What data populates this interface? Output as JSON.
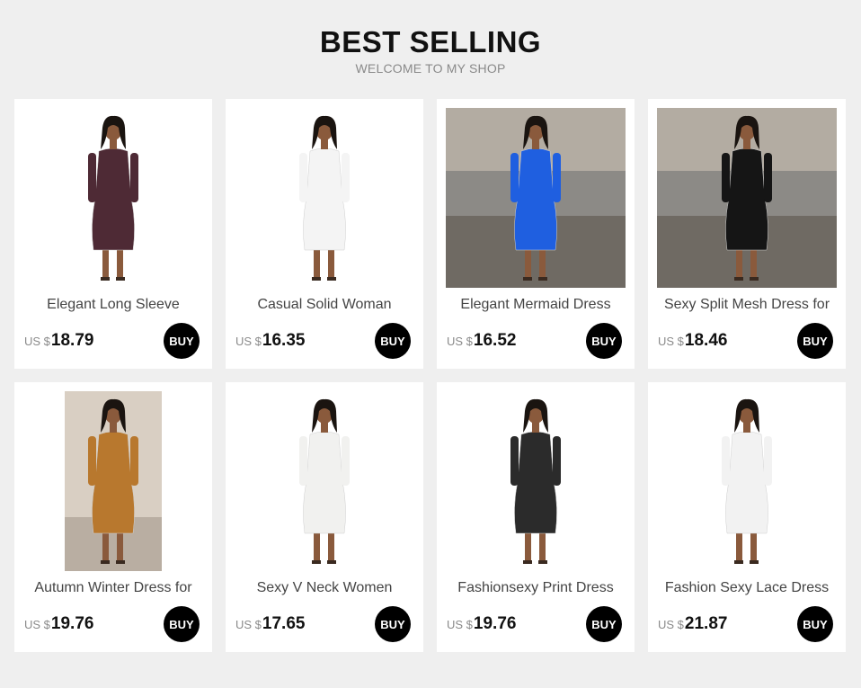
{
  "header": {
    "title": "BEST SELLING",
    "subtitle": "WELCOME TO MY SHOP"
  },
  "colors": {
    "background": "#efefef",
    "card": "#ffffff",
    "buy_button": "#000000"
  },
  "products": [
    {
      "name": "Elegant Long Sleeve",
      "currency": "US $",
      "price": "18.79",
      "buy_label": "BUY",
      "dress_color": "#4e2a35",
      "scene": "studio"
    },
    {
      "name": "Casual Solid Woman",
      "currency": "US $",
      "price": "16.35",
      "buy_label": "BUY",
      "dress_color": "#f4f4f4",
      "scene": "studio"
    },
    {
      "name": "Elegant Mermaid Dress",
      "currency": "US $",
      "price": "16.52",
      "buy_label": "BUY",
      "dress_color": "#1f5fe0",
      "scene": "outdoor"
    },
    {
      "name": "Sexy Split Mesh Dress for",
      "currency": "US $",
      "price": "18.46",
      "buy_label": "BUY",
      "dress_color": "#151515",
      "scene": "outdoor"
    },
    {
      "name": "Autumn Winter Dress for",
      "currency": "US $",
      "price": "19.76",
      "buy_label": "BUY",
      "dress_color": "#b8782e",
      "scene": "street"
    },
    {
      "name": "Sexy V Neck Women",
      "currency": "US $",
      "price": "17.65",
      "buy_label": "BUY",
      "dress_color": "#f1f1ef",
      "scene": "studio"
    },
    {
      "name": "Fashionsexy Print Dress",
      "currency": "US $",
      "price": "19.76",
      "buy_label": "BUY",
      "dress_color": "#2b2b2b",
      "scene": "studio"
    },
    {
      "name": "Fashion Sexy Lace Dress",
      "currency": "US $",
      "price": "21.87",
      "buy_label": "BUY",
      "dress_color": "#f2f2f2",
      "scene": "studio"
    }
  ]
}
